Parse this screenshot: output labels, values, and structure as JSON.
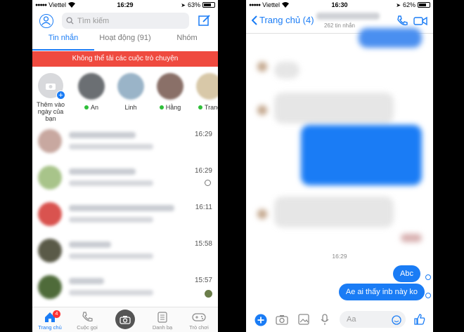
{
  "left": {
    "status": {
      "carrier": "Viettel",
      "time": "16:29",
      "battery": "63%"
    },
    "search": {
      "placeholder": "Tìm kiếm"
    },
    "tabs": [
      "Tin nhắn",
      "Hoạt động (91)",
      "Nhóm"
    ],
    "warning": "Không thể tải các cuộc trò chuyện",
    "stories": [
      {
        "name": "Thêm vào ngày của bạn"
      },
      {
        "name": "An"
      },
      {
        "name": "Linh"
      },
      {
        "name": "Hằng"
      },
      {
        "name": "Trang"
      }
    ],
    "conversations": [
      {
        "time": "16:29"
      },
      {
        "time": "16:29"
      },
      {
        "time": "16:11"
      },
      {
        "time": "15:58"
      },
      {
        "time": "15:57"
      }
    ],
    "nav": [
      {
        "label": "Trang chủ",
        "badge": "4"
      },
      {
        "label": "Cuộc gọi"
      },
      {
        "label": ""
      },
      {
        "label": "Danh bạ"
      },
      {
        "label": "Trò chơi"
      }
    ]
  },
  "right": {
    "status": {
      "carrier": "Viettel",
      "time": "16:30",
      "battery": "62%"
    },
    "back_label": "Trang chủ (4)",
    "subtitle": "262 tin nhắn",
    "time_separator": "16:29",
    "messages": [
      "Abc",
      "Ae ai thấy inb này ko"
    ],
    "input_placeholder": "Aa"
  },
  "colors": {
    "accent": "#1a7cf5",
    "warning": "#ef4a3f"
  }
}
